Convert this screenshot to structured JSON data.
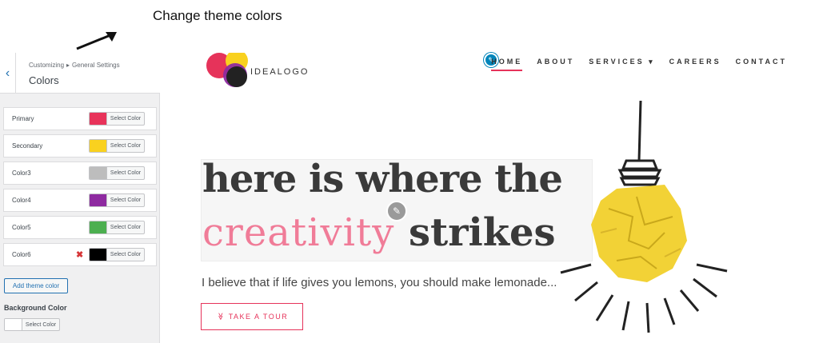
{
  "annotation": {
    "text": "Change theme colors"
  },
  "customizer": {
    "breadcrumb_root": "Customizing",
    "breadcrumb_sep": "▸",
    "breadcrumb_section": "General Settings",
    "title": "Colors",
    "colors": [
      {
        "name": "Primary",
        "color": "#e8335a",
        "select_label": "Select Color"
      },
      {
        "name": "Secondary",
        "color": "#f9d11f",
        "select_label": "Select Color"
      },
      {
        "name": "Color3",
        "color": "#bdbdbd",
        "select_label": "Select Color"
      },
      {
        "name": "Color4",
        "color": "#8e2aa0",
        "select_label": "Select Color"
      },
      {
        "name": "Color5",
        "color": "#4caf50",
        "select_label": "Select Color"
      },
      {
        "name": "Color6",
        "color": "#000000",
        "select_label": "Select Color",
        "removable": true,
        "remove_symbol": "✖"
      }
    ],
    "add_button": "Add theme color",
    "background": {
      "label": "Background Color",
      "color": "#ffffff",
      "select_label": "Select Color"
    }
  },
  "site": {
    "logo_text": "IDEALOGO",
    "nav": [
      "HOME",
      "ABOUT",
      "SERVICES ▾",
      "CAREERS",
      "CONTACT"
    ],
    "nav_active": "HOME",
    "headline_line1": "here is where the",
    "headline_line2_script": "creativity",
    "headline_line2_bold": "strikes",
    "tagline": "I believe that if life gives you lemons, you should make lemonade...",
    "cta_icon": "≫",
    "cta_label": "TAKE A TOUR",
    "accent": "#e6335a"
  },
  "icons": {
    "back": "chevron-left-icon",
    "edit": "pencil-icon",
    "remove": "close-icon",
    "cta": "double-chevron-down-icon"
  }
}
